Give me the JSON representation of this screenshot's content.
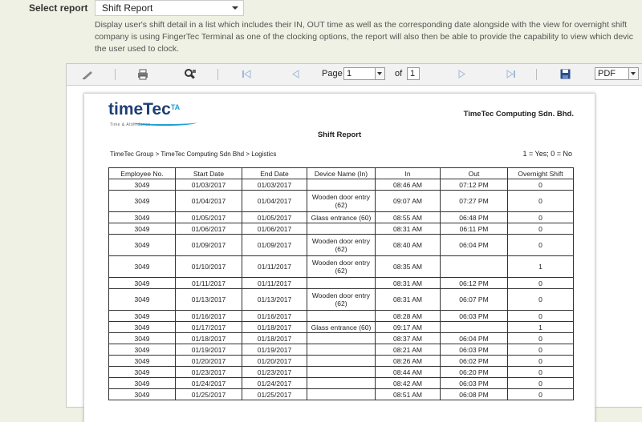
{
  "select_report": {
    "label": "Select report",
    "value": "Shift Report"
  },
  "description": [
    "Display user's shift detail in a list which includes their IN, OUT time as well as the corresponding date alongside with the view for overnight shift",
    "company is using FingerTec Terminal as one of the clocking options, the report will also then be able to provide the capability to view which devic",
    "the user used to clock."
  ],
  "toolbar": {
    "page_label": "Page",
    "page_value": "1",
    "of_label": "of",
    "total_pages": "1",
    "export_format": "PDF"
  },
  "report": {
    "logo_text": "timeTec",
    "logo_sup": "TA",
    "logo_tagline": "Time & Attendance",
    "company": "TimeTec Computing Sdn. Bhd.",
    "title": "Shift Report",
    "breadcrumb": "TimeTec Group > TimeTec Computing Sdn Bhd > Logistics",
    "legend": "1 = Yes; 0 = No",
    "columns": [
      "Employee No.",
      "Start Date",
      "End Date",
      "Device Name (In)",
      "In",
      "Out",
      "Overnight Shift"
    ],
    "rows": [
      [
        "3049",
        "01/03/2017",
        "01/03/2017",
        "",
        "08:46 AM",
        "07:12 PM",
        "0"
      ],
      [
        "3049",
        "01/04/2017",
        "01/04/2017",
        "Wooden door entry (62)",
        "09:07 AM",
        "07:27 PM",
        "0"
      ],
      [
        "3049",
        "01/05/2017",
        "01/05/2017",
        "Glass entrance (60)",
        "08:55 AM",
        "06:48 PM",
        "0"
      ],
      [
        "3049",
        "01/06/2017",
        "01/06/2017",
        "",
        "08:31 AM",
        "06:11 PM",
        "0"
      ],
      [
        "3049",
        "01/09/2017",
        "01/09/2017",
        "Wooden door entry (62)",
        "08:40 AM",
        "06:04 PM",
        "0"
      ],
      [
        "3049",
        "01/10/2017",
        "01/11/2017",
        "Wooden door entry (62)",
        "08:35 AM",
        "",
        "1"
      ],
      [
        "3049",
        "01/11/2017",
        "01/11/2017",
        "",
        "08:31 AM",
        "06:12 PM",
        "0"
      ],
      [
        "3049",
        "01/13/2017",
        "01/13/2017",
        "Wooden door entry (62)",
        "08:31 AM",
        "06:07 PM",
        "0"
      ],
      [
        "3049",
        "01/16/2017",
        "01/16/2017",
        "",
        "08:28 AM",
        "06:03 PM",
        "0"
      ],
      [
        "3049",
        "01/17/2017",
        "01/18/2017",
        "Glass entrance (60)",
        "09:17 AM",
        "",
        "1"
      ],
      [
        "3049",
        "01/18/2017",
        "01/18/2017",
        "",
        "08:37 AM",
        "06:04 PM",
        "0"
      ],
      [
        "3049",
        "01/19/2017",
        "01/19/2017",
        "",
        "08:21 AM",
        "06:03 PM",
        "0"
      ],
      [
        "3049",
        "01/20/2017",
        "01/20/2017",
        "",
        "08:26 AM",
        "06:02 PM",
        "0"
      ],
      [
        "3049",
        "01/23/2017",
        "01/23/2017",
        "",
        "08:44 AM",
        "06:20 PM",
        "0"
      ],
      [
        "3049",
        "01/24/2017",
        "01/24/2017",
        "",
        "08:42 AM",
        "06:03 PM",
        "0"
      ],
      [
        "3049",
        "01/25/2017",
        "01/25/2017",
        "",
        "08:51 AM",
        "06:08 PM",
        "0"
      ]
    ]
  },
  "icons": [
    "edit-icon",
    "print-icon",
    "find-icon",
    "first-page-icon",
    "prev-page-icon",
    "next-page-icon",
    "last-page-icon",
    "save-icon"
  ]
}
